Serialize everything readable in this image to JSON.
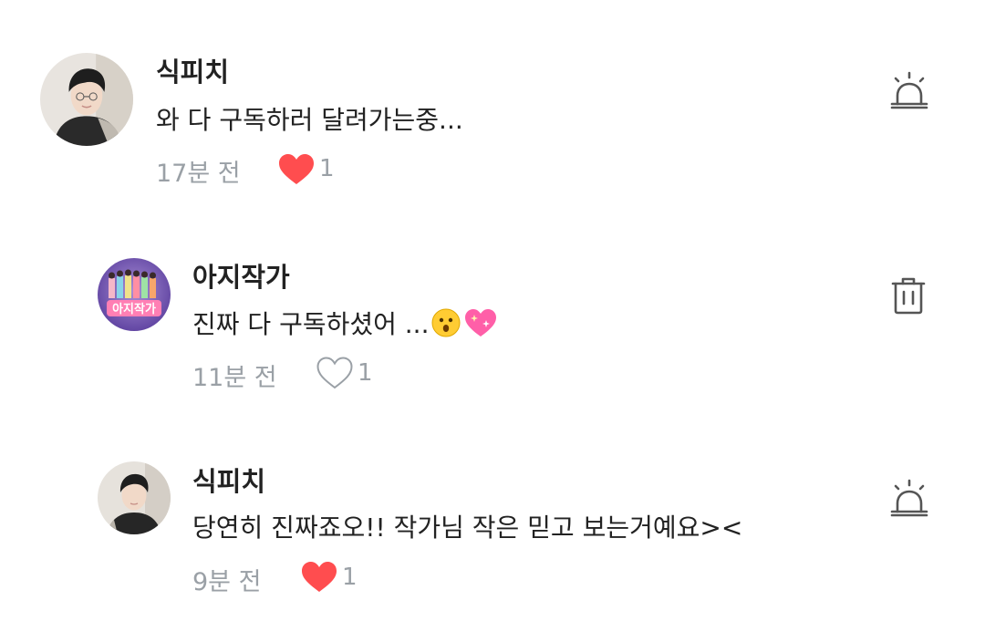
{
  "comments": [
    {
      "author": "식피치",
      "text": "와 다 구독하러 달려가는중...",
      "time": "17분 전",
      "like_count": "1",
      "liked": true,
      "action_icon": "report-siren-icon"
    },
    {
      "author": "아지작가",
      "text": "진짜 다 구독하셨어 ...",
      "emojis": [
        "hushed-face-emoji",
        "sparkling-heart-emoji"
      ],
      "avatar_text": "아지작가",
      "time": "11분 전",
      "like_count": "1",
      "liked": false,
      "action_icon": "trash-icon"
    },
    {
      "author": "식피치",
      "text": "당연히 진짜죠오!! 작가님 작은 믿고 보는거예요><",
      "time": "9분 전",
      "like_count": "1",
      "liked": true,
      "action_icon": "report-siren-icon"
    }
  ],
  "colors": {
    "heart_filled": "#ff4d4f",
    "muted_text": "#9aa0a6",
    "icon_stroke": "#555555"
  }
}
